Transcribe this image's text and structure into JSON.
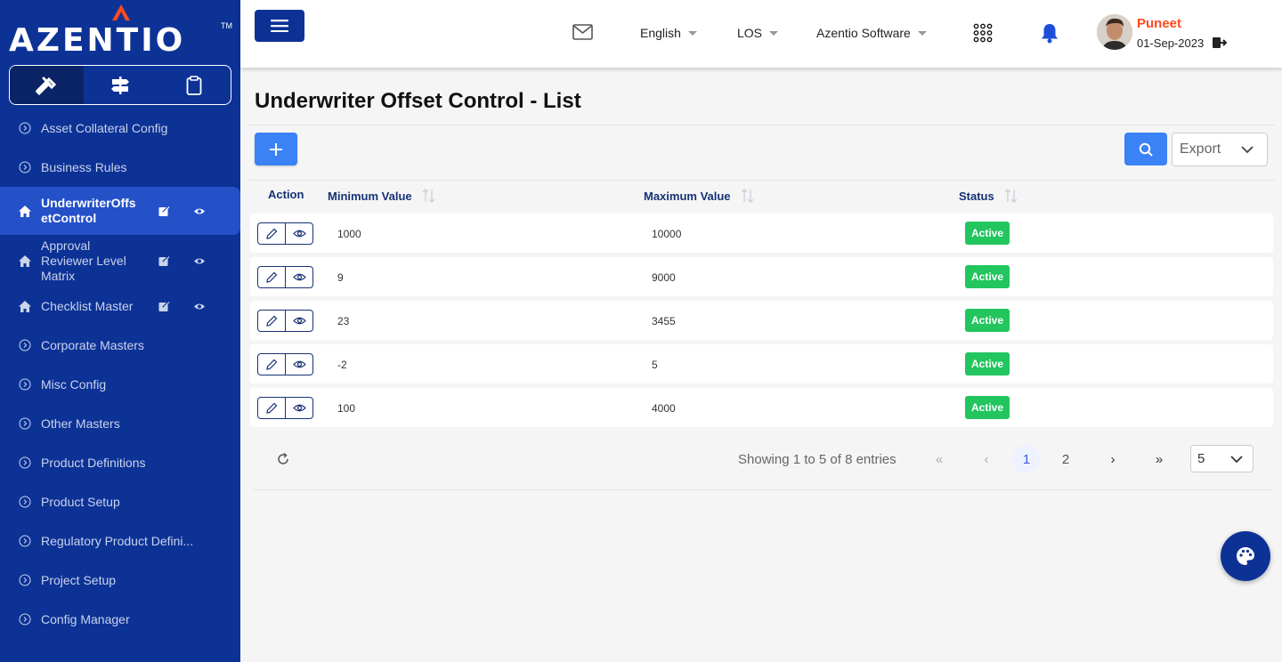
{
  "brand": {
    "name": "AZENTIO",
    "tm": "TM"
  },
  "sidebar": {
    "items": [
      {
        "label": "Asset Collateral Config"
      },
      {
        "label": "Business Rules"
      },
      {
        "label": "UnderwriterOffsetControl"
      },
      {
        "label": "Approval Reviewer Level Matrix"
      },
      {
        "label": "Checklist Master"
      },
      {
        "label": "Corporate Masters"
      },
      {
        "label": "Misc Config"
      },
      {
        "label": "Other Masters"
      },
      {
        "label": "Product Definitions"
      },
      {
        "label": "Product Setup"
      },
      {
        "label": "Regulatory Product Defini..."
      },
      {
        "label": "Project Setup"
      },
      {
        "label": "Config Manager"
      }
    ]
  },
  "topbar": {
    "language": "English",
    "module": "LOS",
    "company": "Azentio Software",
    "user_name": "Puneet",
    "user_date": "01-Sep-2023"
  },
  "page": {
    "title": "Underwriter Offset Control - List",
    "export_label": "Export"
  },
  "table": {
    "headers": {
      "action": "Action",
      "min": "Minimum Value",
      "max": "Maximum Value",
      "status": "Status"
    },
    "rows": [
      {
        "min": "1000",
        "max": "10000",
        "status": "Active"
      },
      {
        "min": "9",
        "max": "9000",
        "status": "Active"
      },
      {
        "min": "23",
        "max": "3455",
        "status": "Active"
      },
      {
        "min": "-2",
        "max": "5",
        "status": "Active"
      },
      {
        "min": "100",
        "max": "4000",
        "status": "Active"
      }
    ]
  },
  "pagination": {
    "summary": "Showing 1 to 5 of 8 entries",
    "first": "«",
    "prev": "‹",
    "pages": [
      "1",
      "2"
    ],
    "next": "›",
    "last": "»",
    "page_size": "5"
  },
  "colors": {
    "sidebar": "#0d3296",
    "accent": "#3b82f6",
    "active_badge": "#22c55e",
    "user_name": "#ff4a1c"
  }
}
